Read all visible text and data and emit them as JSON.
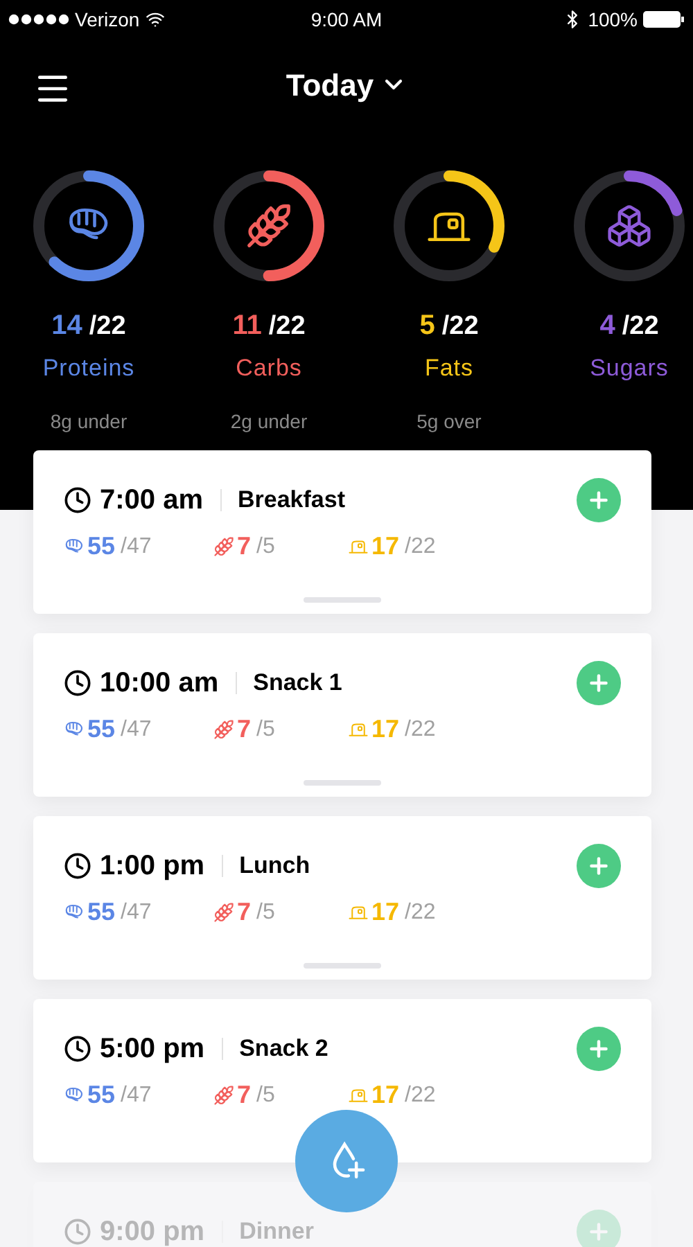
{
  "status_bar": {
    "carrier": "Verizon",
    "time": "9:00 AM",
    "battery": "100%"
  },
  "header": {
    "title": "Today"
  },
  "macros": [
    {
      "kind": "protein",
      "value": "14",
      "target": "/22",
      "label": "Proteins",
      "note": "8g under",
      "level": 0.62,
      "color": "#5b86e5"
    },
    {
      "kind": "carbs",
      "value": "11",
      "target": "/22",
      "label": "Carbs",
      "note": "2g under",
      "level": 0.5,
      "color": "#f25f5c"
    },
    {
      "kind": "fat",
      "value": "5",
      "target": "/22",
      "label": "Fats",
      "note": "5g over",
      "level": 0.32,
      "color": "#f5c518"
    },
    {
      "kind": "sugar",
      "value": "4",
      "target": "/22",
      "label": "Sugars",
      "level": 0.2,
      "color": "#8e5bd9"
    }
  ],
  "meals": [
    {
      "time": "7:00 am",
      "name": "Breakfast",
      "faded": false,
      "handle": true,
      "stats": [
        {
          "kind": "protein",
          "value": "55",
          "target": "/47"
        },
        {
          "kind": "carbs",
          "value": "7",
          "target": "/5"
        },
        {
          "kind": "fat",
          "value": "17",
          "target": "/22"
        }
      ]
    },
    {
      "time": "10:00 am",
      "name": "Snack 1",
      "faded": false,
      "handle": true,
      "stats": [
        {
          "kind": "protein",
          "value": "55",
          "target": "/47"
        },
        {
          "kind": "carbs",
          "value": "7",
          "target": "/5"
        },
        {
          "kind": "fat",
          "value": "17",
          "target": "/22"
        }
      ]
    },
    {
      "time": "1:00 pm",
      "name": "Lunch",
      "faded": false,
      "handle": true,
      "stats": [
        {
          "kind": "protein",
          "value": "55",
          "target": "/47"
        },
        {
          "kind": "carbs",
          "value": "7",
          "target": "/5"
        },
        {
          "kind": "fat",
          "value": "17",
          "target": "/22"
        }
      ]
    },
    {
      "time": "5:00 pm",
      "name": "Snack 2",
      "faded": false,
      "handle": false,
      "stats": [
        {
          "kind": "protein",
          "value": "55",
          "target": "/47"
        },
        {
          "kind": "carbs",
          "value": "7",
          "target": "/5"
        },
        {
          "kind": "fat",
          "value": "17",
          "target": "/22"
        }
      ]
    },
    {
      "time": "9:00 pm",
      "name": "Dinner",
      "faded": true,
      "handle": false
    }
  ]
}
